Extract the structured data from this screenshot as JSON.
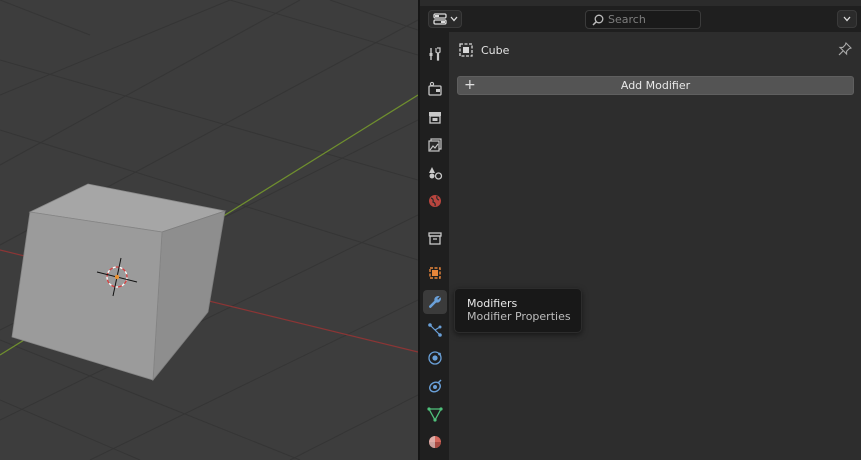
{
  "viewport": {
    "object": "cube",
    "accent_x_axis": "#8b3535",
    "accent_y_axis": "#6f8f2e"
  },
  "header": {
    "search_placeholder": "Search"
  },
  "context": {
    "object_name": "Cube"
  },
  "modifiers": {
    "add_label": "Add Modifier"
  },
  "tabs": [
    {
      "name": "tool",
      "icon": "tool-icon"
    },
    {
      "name": "render",
      "icon": "render-icon"
    },
    {
      "name": "output",
      "icon": "output-icon"
    },
    {
      "name": "view-layer",
      "icon": "view-layer-icon"
    },
    {
      "name": "scene",
      "icon": "scene-icon"
    },
    {
      "name": "world",
      "icon": "world-icon"
    },
    {
      "name": "collection",
      "icon": "collection-icon"
    },
    {
      "name": "object",
      "icon": "object-icon"
    },
    {
      "name": "modifiers",
      "icon": "wrench-icon",
      "active": true
    },
    {
      "name": "particles",
      "icon": "particles-icon"
    },
    {
      "name": "physics",
      "icon": "physics-icon"
    },
    {
      "name": "constraints",
      "icon": "constraints-icon"
    },
    {
      "name": "data",
      "icon": "mesh-data-icon"
    },
    {
      "name": "material",
      "icon": "material-icon"
    }
  ],
  "tooltip": {
    "title": "Modifiers",
    "description": "Modifier Properties"
  },
  "colors": {
    "active_tab": "#3b3b3b",
    "object_orange": "#e8863a",
    "modifier_blue": "#6aa0d8",
    "data_green": "#4fc17b"
  }
}
